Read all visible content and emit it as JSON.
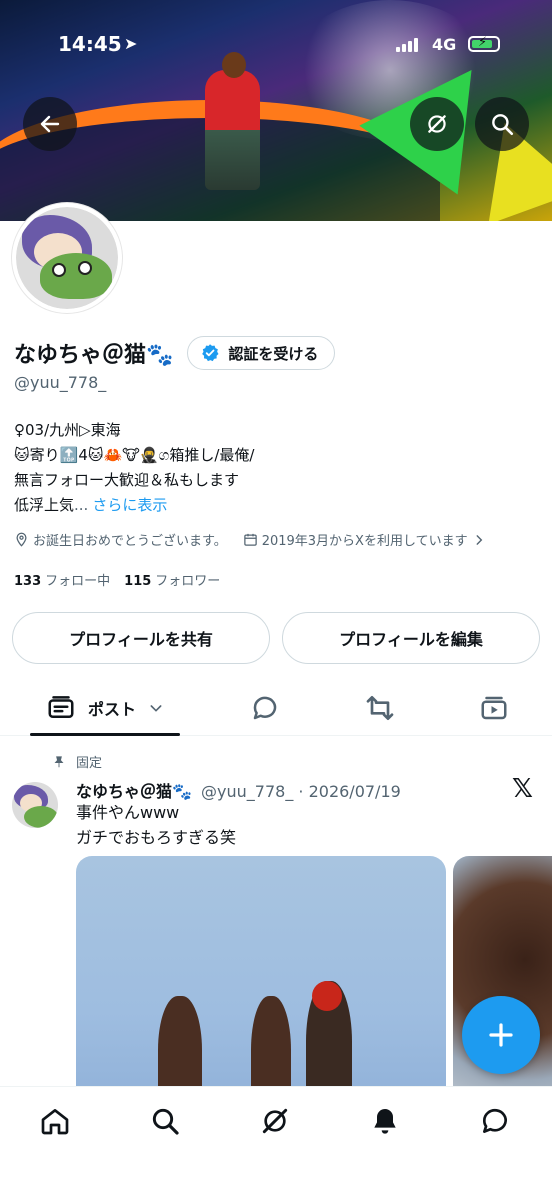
{
  "status_bar": {
    "time": "14:45",
    "network": "4G"
  },
  "profile": {
    "display_name": "なゆちゃ＠猫🐾",
    "verify_button_label": "認証を受ける",
    "handle": "@yuu_778_",
    "bio_lines": [
      "♀03/九州▷東海",
      "🐱寄り🔝4🐱🦀🐮🥷ග箱推し/最俺/",
      "無言フォロー大歓迎＆私もします"
    ],
    "bio_last": "低浮上気",
    "bio_ellipsis": "...",
    "bio_more": "さらに表示",
    "birthday_text": "お誕生日おめでとうございます。",
    "joined_text": "2019年3月からXを利用しています",
    "following_count": "133",
    "following_label": "フォロー中",
    "followers_count": "115",
    "followers_label": "フォロワー",
    "share_button": "プロフィールを共有",
    "edit_button": "プロフィールを編集"
  },
  "tabs": {
    "posts_label": "ポスト"
  },
  "pinned_post": {
    "pinned_label": "固定",
    "author_name": "なゆちゃ＠猫🐾",
    "meta": "@yuu_778_ · 2026/07/19",
    "lines": [
      "事件やんwww",
      "ガチでおもろすぎる笑"
    ],
    "x_logo": "𝕏"
  },
  "colors": {
    "accent": "#1d9bf0",
    "text": "#0f1419",
    "muted": "#536471"
  },
  "icons": {
    "header": [
      "back-arrow-icon",
      "grok-icon",
      "search-icon"
    ],
    "tabs": [
      "posts-icon",
      "reply-icon",
      "repost-icon",
      "media-icon"
    ],
    "bottom_nav": [
      "home-icon",
      "search-icon",
      "grok-icon",
      "notifications-icon",
      "messages-icon"
    ]
  }
}
